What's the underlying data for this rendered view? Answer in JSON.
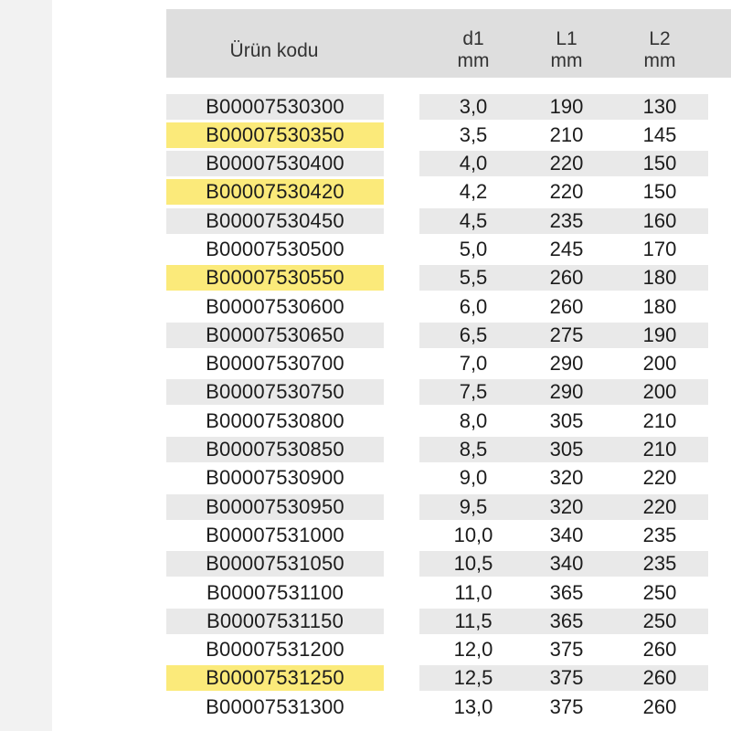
{
  "header": {
    "code_label": "Ürün kodu",
    "d1_label": "d1",
    "d1_unit": "mm",
    "l1_label": "L1",
    "l1_unit": "mm",
    "l2_label": "L2",
    "l2_unit": "mm"
  },
  "highlight_color": "#fbea7a",
  "rows": [
    {
      "code": "B00007530300",
      "d1": "3,0",
      "l1": "190",
      "l2": "130",
      "highlight": false
    },
    {
      "code": "B00007530350",
      "d1": "3,5",
      "l1": "210",
      "l2": "145",
      "highlight": true
    },
    {
      "code": "B00007530400",
      "d1": "4,0",
      "l1": "220",
      "l2": "150",
      "highlight": false
    },
    {
      "code": "B00007530420",
      "d1": "4,2",
      "l1": "220",
      "l2": "150",
      "highlight": true
    },
    {
      "code": "B00007530450",
      "d1": "4,5",
      "l1": "235",
      "l2": "160",
      "highlight": false
    },
    {
      "code": "B00007530500",
      "d1": "5,0",
      "l1": "245",
      "l2": "170",
      "highlight": false
    },
    {
      "code": "B00007530550",
      "d1": "5,5",
      "l1": "260",
      "l2": "180",
      "highlight": true
    },
    {
      "code": "B00007530600",
      "d1": "6,0",
      "l1": "260",
      "l2": "180",
      "highlight": false
    },
    {
      "code": "B00007530650",
      "d1": "6,5",
      "l1": "275",
      "l2": "190",
      "highlight": false
    },
    {
      "code": "B00007530700",
      "d1": "7,0",
      "l1": "290",
      "l2": "200",
      "highlight": false
    },
    {
      "code": "B00007530750",
      "d1": "7,5",
      "l1": "290",
      "l2": "200",
      "highlight": false
    },
    {
      "code": "B00007530800",
      "d1": "8,0",
      "l1": "305",
      "l2": "210",
      "highlight": false
    },
    {
      "code": "B00007530850",
      "d1": "8,5",
      "l1": "305",
      "l2": "210",
      "highlight": false
    },
    {
      "code": "B00007530900",
      "d1": "9,0",
      "l1": "320",
      "l2": "220",
      "highlight": false
    },
    {
      "code": "B00007530950",
      "d1": "9,5",
      "l1": "320",
      "l2": "220",
      "highlight": false
    },
    {
      "code": "B00007531000",
      "d1": "10,0",
      "l1": "340",
      "l2": "235",
      "highlight": false
    },
    {
      "code": "B00007531050",
      "d1": "10,5",
      "l1": "340",
      "l2": "235",
      "highlight": false
    },
    {
      "code": "B00007531100",
      "d1": "11,0",
      "l1": "365",
      "l2": "250",
      "highlight": false
    },
    {
      "code": "B00007531150",
      "d1": "11,5",
      "l1": "365",
      "l2": "250",
      "highlight": false
    },
    {
      "code": "B00007531200",
      "d1": "12,0",
      "l1": "375",
      "l2": "260",
      "highlight": false
    },
    {
      "code": "B00007531250",
      "d1": "12,5",
      "l1": "375",
      "l2": "260",
      "highlight": true
    },
    {
      "code": "B00007531300",
      "d1": "13,0",
      "l1": "375",
      "l2": "260",
      "highlight": false
    }
  ]
}
